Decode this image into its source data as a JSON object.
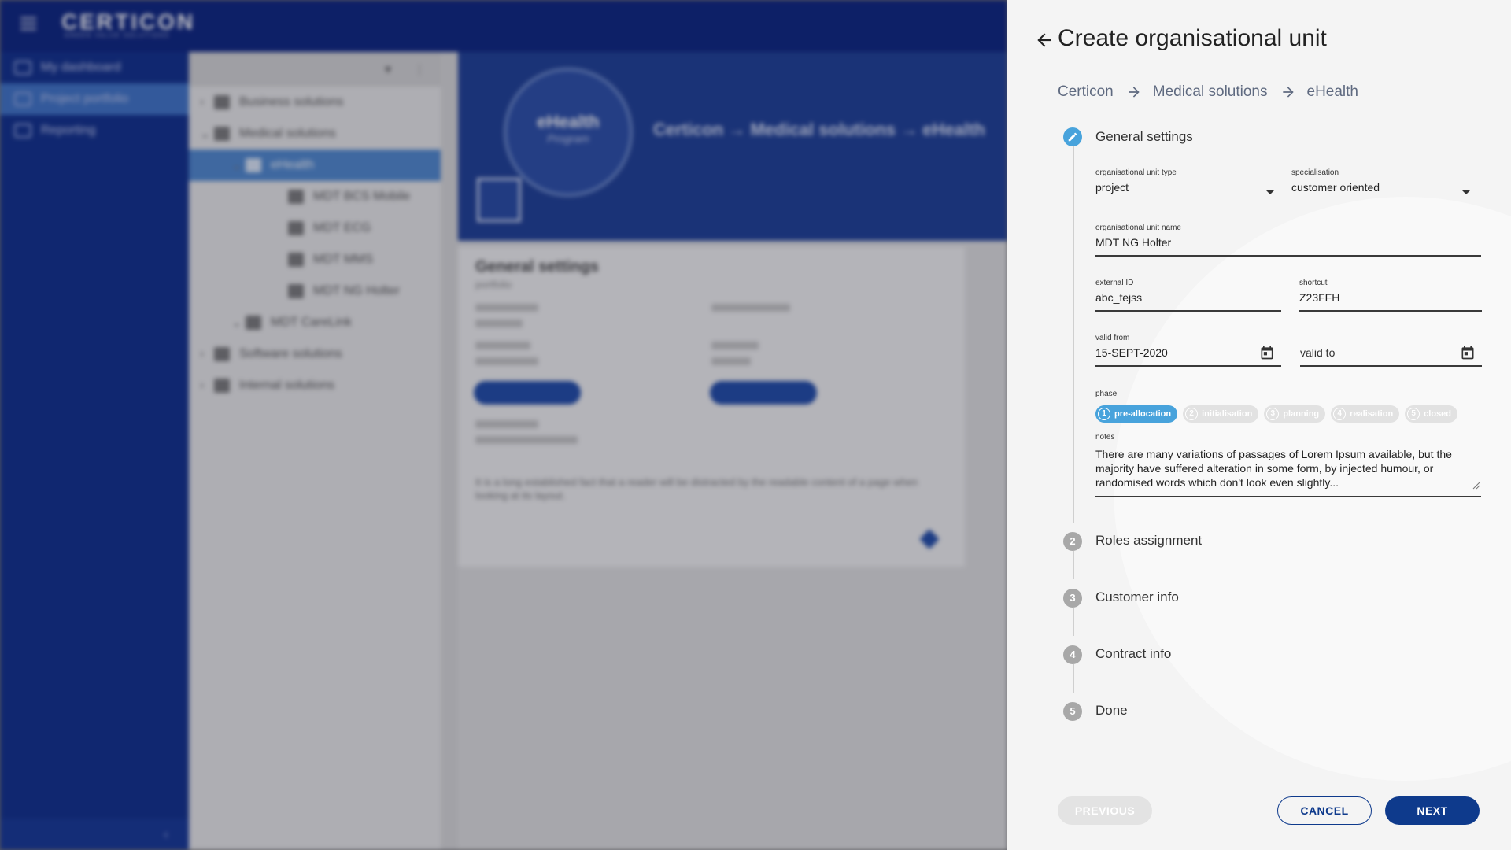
{
  "app": {
    "logo": "CERTICON",
    "logo_tagline": "GREEN VALUE SOLUTIONS",
    "nav": [
      {
        "label": "My dashboard"
      },
      {
        "label": "Project portfolio"
      },
      {
        "label": "Reporting"
      }
    ],
    "tree": [
      {
        "label": "Business solutions",
        "level": 0
      },
      {
        "label": "Medical solutions",
        "level": 0
      },
      {
        "label": "eHealth",
        "level": 1
      },
      {
        "label": "MDT BCS Mobile",
        "level": 2
      },
      {
        "label": "MDT ECG",
        "level": 2
      },
      {
        "label": "MDT MMS",
        "level": 2
      },
      {
        "label": "MDT NG Holter",
        "level": 2
      },
      {
        "label": "MDT CareLink",
        "level": 1
      },
      {
        "label": "Software solutions",
        "level": 0
      },
      {
        "label": "Internal solutions",
        "level": 0
      }
    ],
    "hero": {
      "name": "eHealth",
      "type": "Program",
      "crumb": "Certicon → Medical solutions → eHealth"
    },
    "card": {
      "title": "General settings",
      "subtitle": "portfolio",
      "text": "It is a long established fact that a reader will be distracted by the readable content of a page when looking at its layout."
    }
  },
  "panel": {
    "title": "Create organisational unit",
    "breadcrumb": [
      "Certicon",
      "Medical solutions",
      "eHealth"
    ],
    "steps": [
      {
        "number": "1",
        "label": "General settings"
      },
      {
        "number": "2",
        "label": "Roles assignment"
      },
      {
        "number": "3",
        "label": "Customer info"
      },
      {
        "number": "4",
        "label": "Contract info"
      },
      {
        "number": "5",
        "label": "Done"
      }
    ],
    "fields": {
      "unit_type": {
        "label": "organisational unit type",
        "value": "project"
      },
      "specialisation": {
        "label": "specialisation",
        "value": "customer oriented"
      },
      "unit_name": {
        "label": "organisational unit name",
        "value": "MDT NG Holter"
      },
      "external_id": {
        "label": "external ID",
        "value": "abc_fejss"
      },
      "shortcut": {
        "label": "shortcut",
        "value": "Z23FFH"
      },
      "valid_from": {
        "label": "valid from",
        "value": "15-SEPT-2020"
      },
      "valid_to": {
        "label": "",
        "placeholder": "valid to"
      }
    },
    "phase": {
      "label": "phase",
      "chips": [
        {
          "number": "1",
          "label": "pre-allocation",
          "active": true
        },
        {
          "number": "2",
          "label": "initialisation",
          "active": false
        },
        {
          "number": "3",
          "label": "planning",
          "active": false
        },
        {
          "number": "4",
          "label": "realisation",
          "active": false
        },
        {
          "number": "5",
          "label": "closed",
          "active": false
        }
      ]
    },
    "notes": {
      "label": "notes",
      "value": "There are many variations of passages of Lorem Ipsum available, but the majority have suffered alteration in some form, by injected humour, or randomised words which don't look even slightly..."
    },
    "buttons": {
      "previous": "PREVIOUS",
      "cancel": "CANCEL",
      "next": "NEXT"
    }
  },
  "colors": {
    "primary": "#0e3a8c",
    "accent": "#48a3dc",
    "topbar": "#0b2480"
  }
}
